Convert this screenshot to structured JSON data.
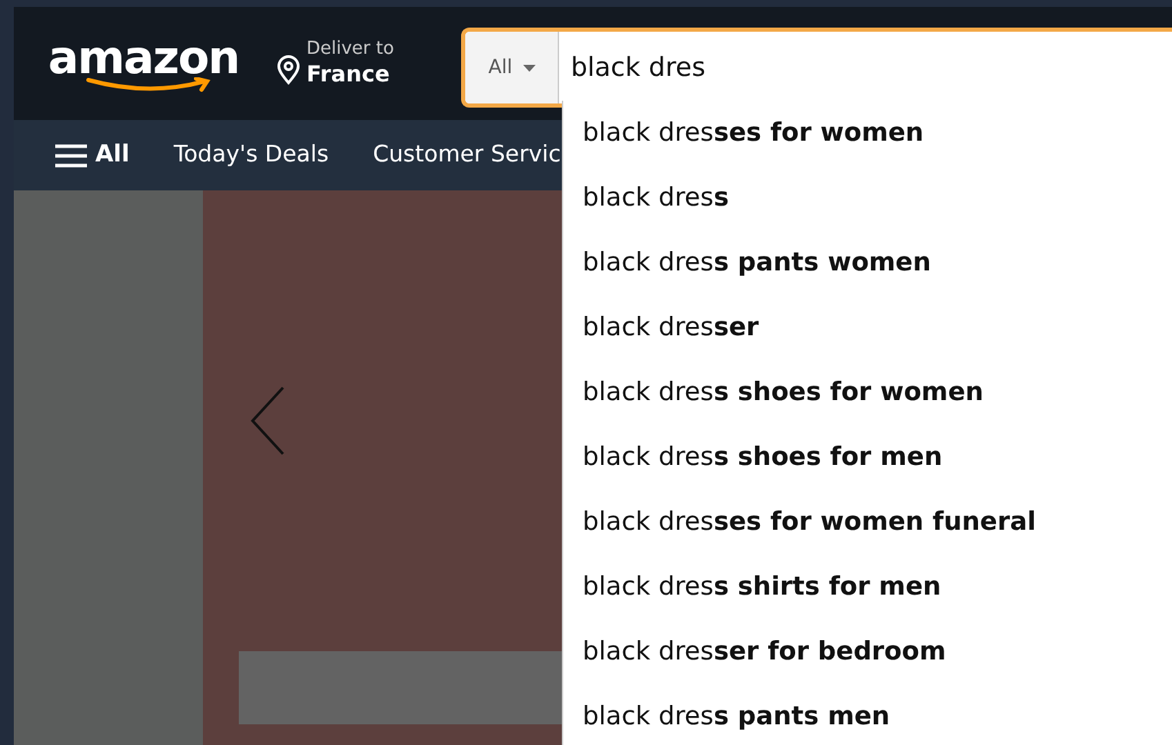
{
  "header": {
    "logo": "amazon",
    "deliver": {
      "label": "Deliver to",
      "location": "France"
    },
    "search": {
      "category": "All",
      "value": "black dres"
    }
  },
  "nav": {
    "items": [
      {
        "kind": "menu",
        "label": "All"
      },
      {
        "kind": "link",
        "label": "Today's Deals"
      },
      {
        "kind": "link",
        "label": "Customer Servic"
      }
    ]
  },
  "suggestions": [
    "black dres**ses for women**",
    "black dres**s**",
    "black dres**s pants women**",
    "black dres**ser**",
    "black dres**s shoes for women**",
    "black dres**s shoes for men**",
    "black dres**ses for women funeral**",
    "black dres**s shirts for men**",
    "black dres**ser for bedroom**",
    "black dres**s pants men**"
  ]
}
